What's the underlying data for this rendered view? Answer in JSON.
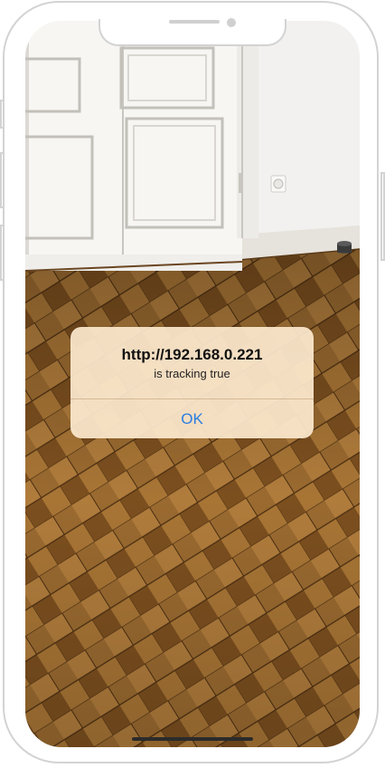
{
  "alert": {
    "title": "http://192.168.0.221",
    "message": "is tracking true",
    "ok_label": "OK"
  },
  "colors": {
    "alert_background": "#fce8cd",
    "button_text": "#2a7de1",
    "floor": "#8a5a26",
    "wall": "#f2f1ef"
  },
  "icons": {
    "front_camera": "front-camera-icon",
    "speaker": "speaker-grille-icon"
  }
}
